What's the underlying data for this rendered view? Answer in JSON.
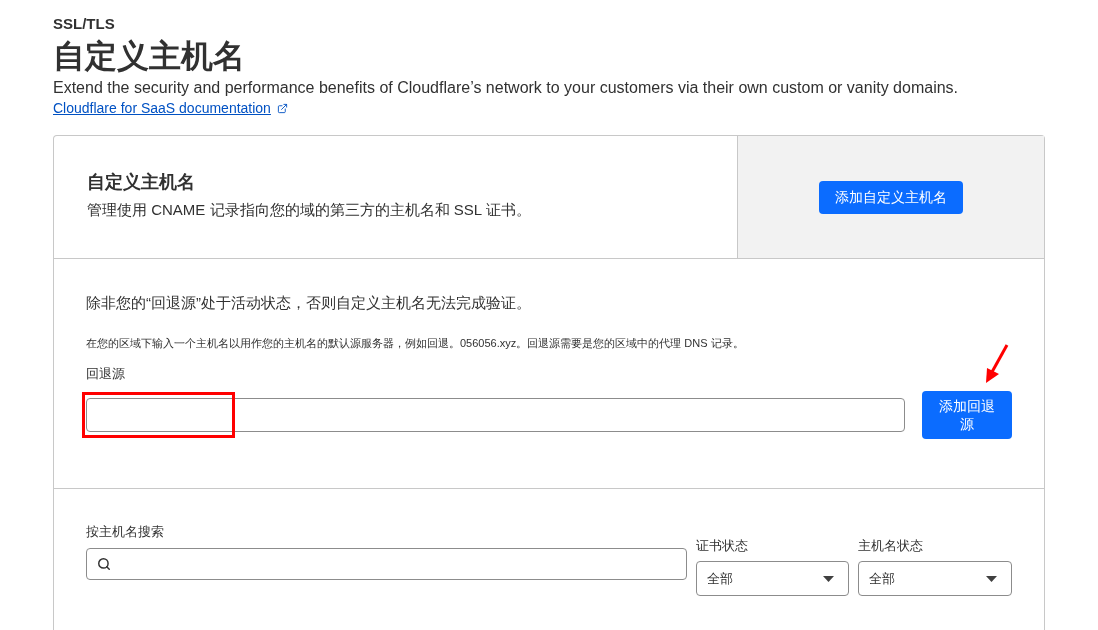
{
  "breadcrumb": "SSL/TLS",
  "title": "自定义主机名",
  "description": "Extend the security and performance benefits of Cloudflare’s network to your customers via their own custom or vanity domains.",
  "doc_link": "Cloudflare for SaaS documentation",
  "custom_hostnames_card": {
    "title": "自定义主机名",
    "description": "管理使用 CNAME 记录指向您的域的第三方的主机名和 SSL 证书。",
    "button": "添加自定义主机名"
  },
  "fallback_origin": {
    "notice": "除非您的“回退源”处于活动状态，否则自定义主机名无法完成验证。",
    "help": "在您的区域下输入一个主机名以用作您的主机名的默认源服务器，例如回退。056056.xyz。回退源需要是您的区域中的代理 DNS 记录。",
    "label": "回退源",
    "button": "添加回退源",
    "input_annotation": {
      "kind": "highlight-box"
    },
    "button_annotation": {
      "kind": "arrow"
    }
  },
  "filters": {
    "search_label": "按主机名搜索",
    "selects": [
      {
        "label": "证书状态",
        "value": "全部"
      },
      {
        "label": "主机名状态",
        "value": "全部"
      }
    ]
  }
}
